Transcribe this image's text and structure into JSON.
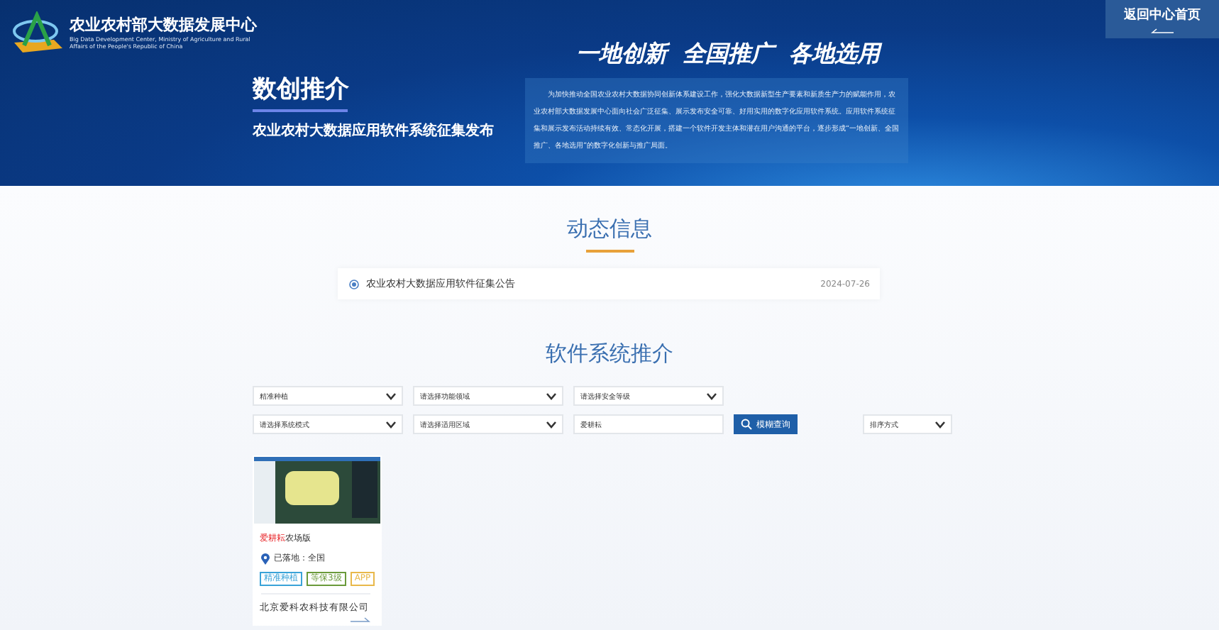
{
  "header": {
    "org_name": "农业农村部大数据发展中心",
    "org_name_en": "Big Data Development Center, Ministry of Agriculture and Rural Affairs of the People's Republic of China",
    "title": "数创推介",
    "subtitle": "农业农村大数据应用软件系统征集发布",
    "slogan": "一地创新  全国推广  各地选用",
    "intro": "为加快推动全国农业农村大数据协同创新体系建设工作，强化大数据新型生产要素和新质生产力的赋能作用，农业农村部大数据发展中心面向社会广泛征集、展示发布安全可靠、好用实用的数字化应用软件系统。应用软件系统征集和展示发布活动持续有效、常态化开展，搭建一个软件开发主体和潜在用户沟通的平台，逐步形成“一地创新、全国推广、各地选用”的数字化创新与推广局面。",
    "back_button": "返回中心首页"
  },
  "news": {
    "heading": "动态信息",
    "items": [
      {
        "title": "农业农村大数据应用软件征集公告",
        "date": "2024-07-26"
      }
    ]
  },
  "software": {
    "heading": "软件系统推介",
    "filters": [
      {
        "kind": "select",
        "value": "精准种植"
      },
      {
        "kind": "select",
        "value": "请选择功能领域"
      },
      {
        "kind": "select",
        "value": "请选择安全等级"
      },
      {
        "kind": "select",
        "value": "请选择系统模式"
      },
      {
        "kind": "select",
        "value": "请选择适用区域"
      },
      {
        "kind": "input",
        "value": "爱耕耘"
      }
    ],
    "search_button": "模糊查询",
    "sort": "排序方式",
    "cards": [
      {
        "name_highlight": "爱耕耘",
        "name_rest": "农场版",
        "location": "已落地：全国",
        "tags": [
          {
            "text": "精准种植",
            "color": "#3aa3d8"
          },
          {
            "text": "等保3级",
            "color": "#6a9a3a"
          },
          {
            "text": "APP",
            "color": "#e8b84a"
          }
        ],
        "company": "北京爱科农科技有限公司"
      }
    ]
  }
}
